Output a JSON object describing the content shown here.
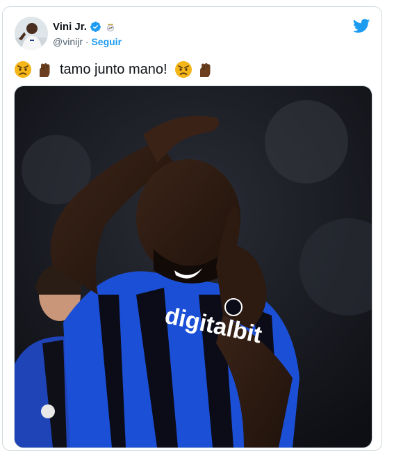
{
  "tweet": {
    "author": {
      "display_name": "Vini Jr.",
      "handle": "@vinijr",
      "separator": "·",
      "follow_label": "Seguir",
      "verified_icon": "verified-badge-icon",
      "club_icon": "real-madrid-crest-icon",
      "avatar_icon": "avatar-photo"
    },
    "text": {
      "words": "tamo junto mano!",
      "emojis_before": [
        "angry-face-icon",
        "raised-fist-icon"
      ],
      "emojis_after": [
        "angry-face-icon",
        "raised-fist-icon"
      ]
    },
    "media": {
      "jersey_sponsor": "digitalbit",
      "icon": "photo"
    },
    "brand_icon": "twitter-bird-icon"
  },
  "colors": {
    "accent": "#1d9bf0",
    "muted_text": "#536471",
    "border": "#cfd9de",
    "angry_face": "#f4b619",
    "fist": "#6b3f1f"
  }
}
